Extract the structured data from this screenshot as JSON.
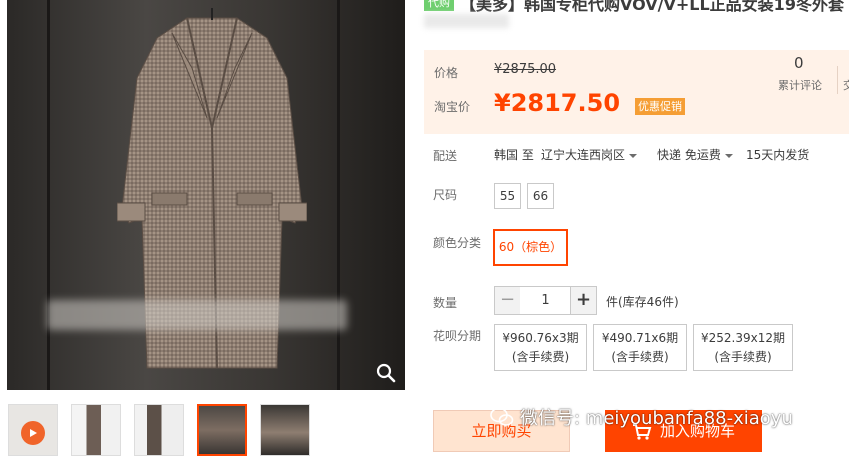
{
  "product": {
    "tag": "代购",
    "title": "【美多】韩国专柜代购VOV/V+LL正品女装19冬外套"
  },
  "price": {
    "orig_label": "价格",
    "orig_value": "¥2875.00",
    "sale_label": "淘宝价",
    "sale_value": "¥2817.50",
    "promo": "优惠促销"
  },
  "reviews": {
    "count": "0",
    "label": "累计评论",
    "cut_label": "交"
  },
  "shipping": {
    "label": "配送",
    "from": "韩国 至",
    "to": "辽宁大连西岗区",
    "method": "快递 免运费",
    "time": "15天内发货"
  },
  "size": {
    "label": "尺码",
    "options": [
      "55",
      "66"
    ]
  },
  "color": {
    "label": "颜色分类",
    "selected": "60（棕色）"
  },
  "quantity": {
    "label": "数量",
    "minus": "−",
    "value": "1",
    "plus": "+",
    "unit": "件(库存46件)"
  },
  "installment": {
    "label": "花呗分期",
    "options": [
      {
        "amount": "¥960.76x3期",
        "fee": "(含手续费)"
      },
      {
        "amount": "¥490.71x6期",
        "fee": "(含手续费)"
      },
      {
        "amount": "¥252.39x12期",
        "fee": "(含手续费)"
      }
    ]
  },
  "actions": {
    "buy_now": "立即购买",
    "add_cart": "加入购物车"
  },
  "watermark": "微信号: meiyoubanfa88-xiaoyu",
  "colors": {
    "accent": "#ff4400",
    "price_bg": "#fff2e8",
    "promo": "#f59e34",
    "tag_green": "#6fcf6f"
  },
  "icons": [
    "zoom-icon",
    "play-icon",
    "cart-icon",
    "wechat-icon",
    "caret-down-icon"
  ]
}
